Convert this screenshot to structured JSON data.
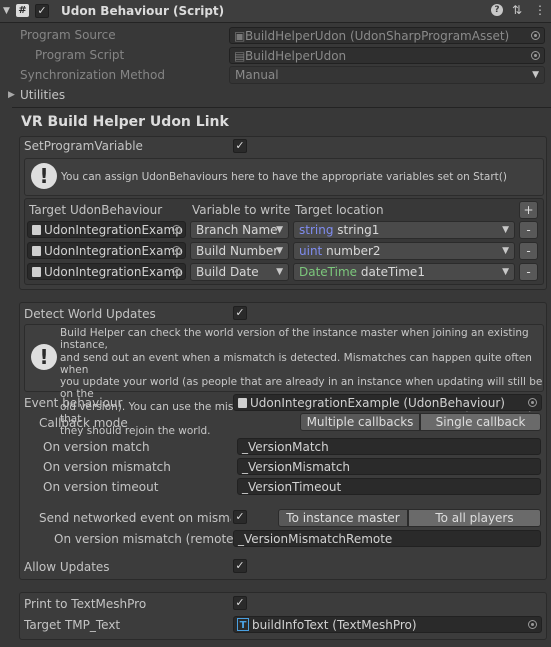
{
  "component": {
    "title": "Udon Behaviour (Script)",
    "enabled_check": "✓",
    "help_icon": "question-icon",
    "settings_icon": "sliders-icon",
    "menu_icon": "kebab-icon"
  },
  "program_source": {
    "label": "Program Source",
    "value": "BuildHelperUdon (UdonSharpProgramAsset)"
  },
  "program_script": {
    "label": "Program Script",
    "value": "BuildHelperUdon"
  },
  "sync_method": {
    "label": "Synchronization Method",
    "value": "Manual"
  },
  "utilities": {
    "label": "Utilities"
  },
  "section_title": "VR Build Helper Udon Link",
  "set_program_variable": {
    "label": "SetProgramVariable",
    "check": "✓",
    "help": "You can assign UdonBehaviours here to have the appropriate variables set on Start()",
    "headers": [
      "Target UdonBehaviour",
      "Variable to write",
      "Target location"
    ],
    "add": "+",
    "rows": [
      {
        "target": "UdonIntegrationExamp",
        "variable": "Branch Name",
        "type": "string",
        "name": "string1",
        "remove": "-"
      },
      {
        "target": "UdonIntegrationExamp",
        "variable": "Build Number",
        "type": "uint",
        "name": "number2",
        "remove": "-"
      },
      {
        "target": "UdonIntegrationExamp",
        "variable": "Build Date",
        "type": "DateTime",
        "name": "dateTime1",
        "remove": "-"
      }
    ]
  },
  "detect": {
    "label": "Detect World Updates",
    "check": "✓",
    "help": [
      "Build Helper can check the world version of the instance master when joining an existing instance,",
      "and send out an event when a mismatch is detected. Mismatches can happen quite often when",
      "you update your world (as people that are already in an instance when updating will still be on the",
      "old version). You can use the mismatch and timeout events to alert the user (and master) that",
      "they should rejoin the world."
    ],
    "event_behaviour_label": "Event behaviour",
    "event_behaviour_value": "UdonIntegrationExample (UdonBehaviour)",
    "callback_label": "Callback mode",
    "callback_multiple": "Multiple callbacks",
    "callback_single": "Single callback",
    "match_label": "On version match",
    "match_value": "_VersionMatch",
    "mismatch_label": "On version mismatch",
    "mismatch_value": "_VersionMismatch",
    "timeout_label": "On version timeout",
    "timeout_value": "_VersionTimeout",
    "send_label": "Send networked event on mismatc",
    "send_check": "✓",
    "to_master": "To instance master",
    "to_all": "To all players",
    "remote_label": "On version mismatch (remote)",
    "remote_value": "_VersionMismatchRemote",
    "allow_label": "Allow Updates",
    "allow_check": "✓"
  },
  "tmp": {
    "print_label": "Print to TextMeshPro",
    "print_check": "✓",
    "target_label": "Target TMP_Text",
    "target_icon": "T",
    "target_value": "buildInfoText (TextMeshPro)"
  }
}
